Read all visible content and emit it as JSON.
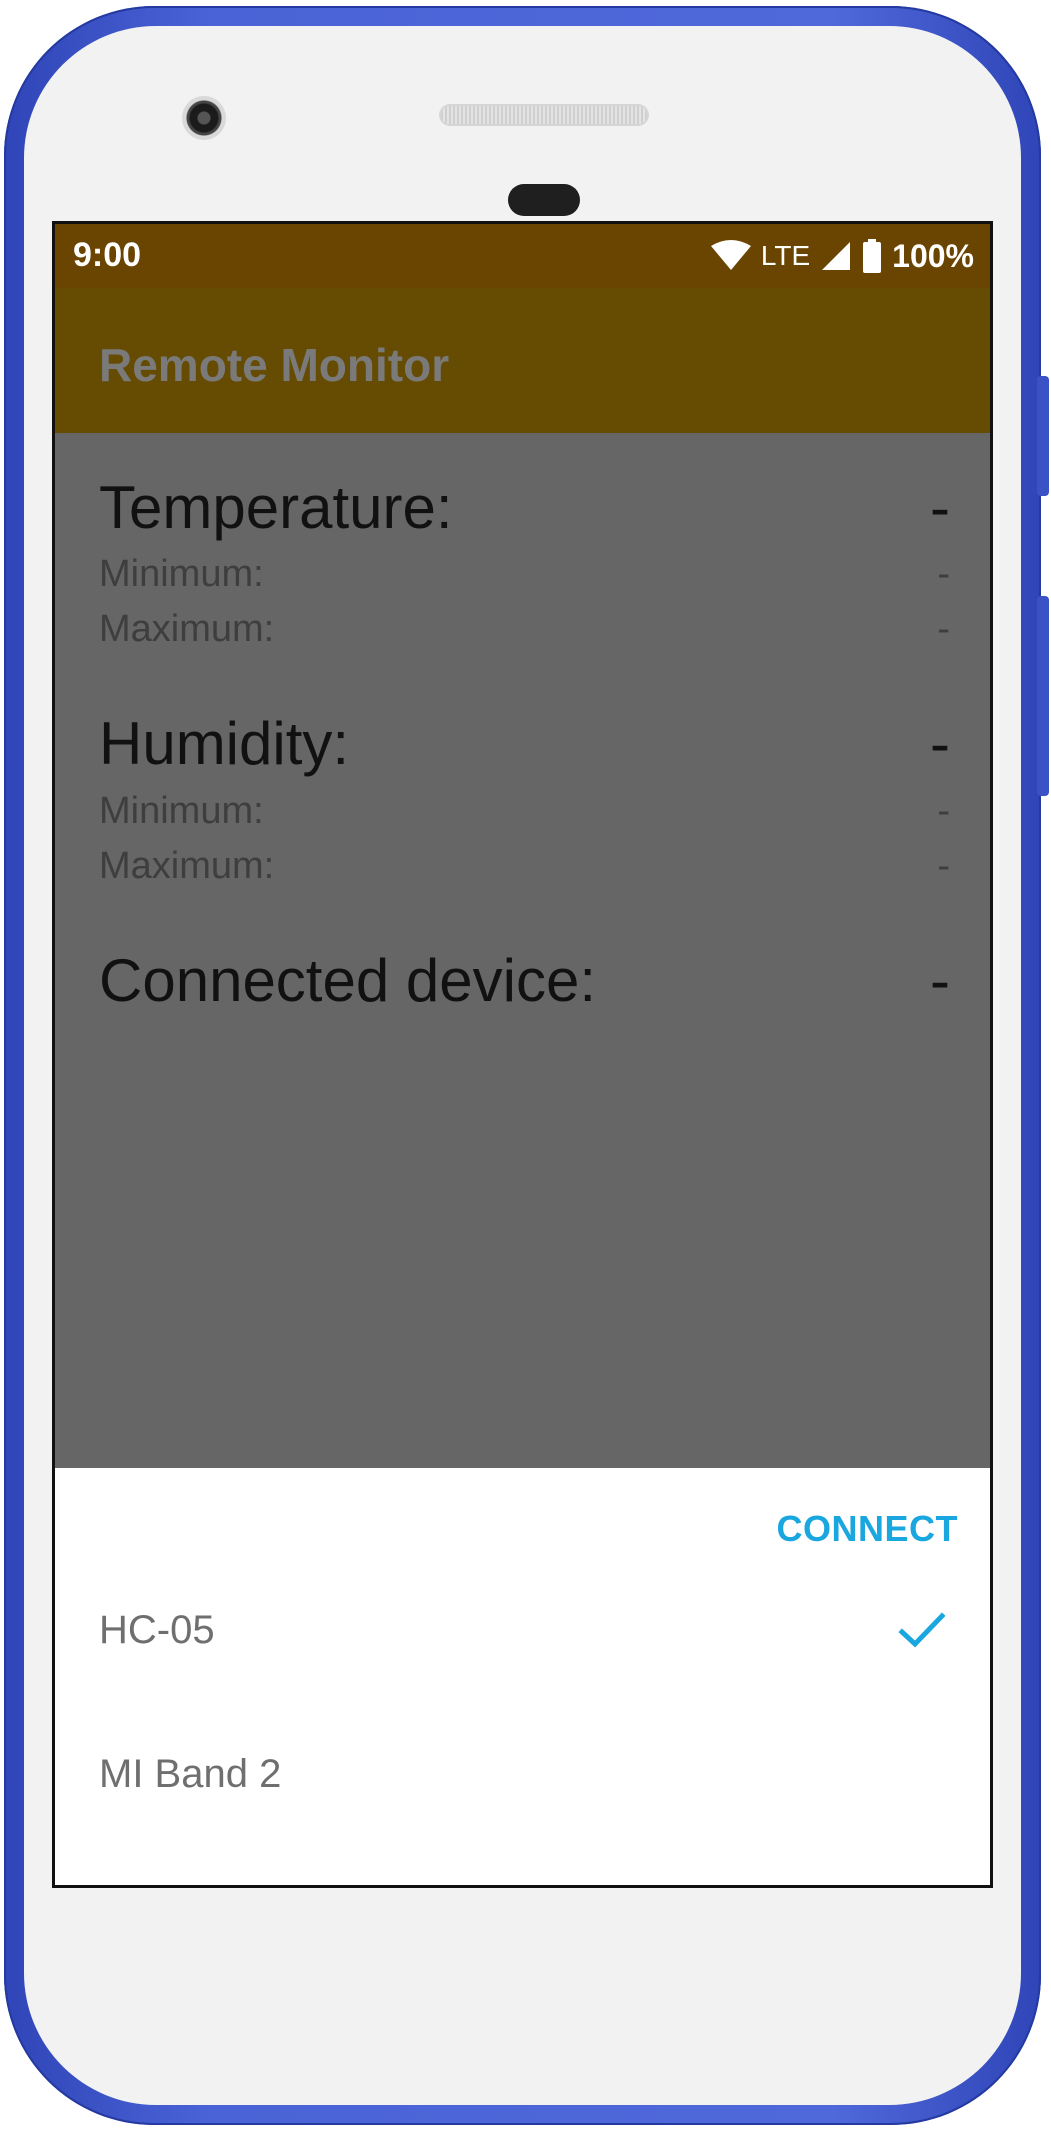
{
  "status_bar": {
    "time": "9:00",
    "network": "LTE",
    "battery": "100%",
    "icons": [
      "wifi-icon",
      "signal-icon",
      "battery-icon"
    ]
  },
  "app": {
    "title": "Remote Monitor"
  },
  "readings": {
    "temperature": {
      "label": "Temperature:",
      "value": "-",
      "min_label": "Minimum:",
      "min_value": "-",
      "max_label": "Maximum:",
      "max_value": "-"
    },
    "humidity": {
      "label": "Humidity:",
      "value": "-",
      "min_label": "Minimum:",
      "min_value": "-",
      "max_label": "Maximum:",
      "max_value": "-"
    },
    "connected_device": {
      "label": "Connected device:",
      "value": "-"
    }
  },
  "sheet": {
    "connect_label": "CONNECT",
    "devices": [
      {
        "name": "HC-05",
        "selected": true
      },
      {
        "name": "MI Band 2",
        "selected": false
      }
    ]
  },
  "colors": {
    "status_bar": "#6a4401",
    "app_bar": "#664c02",
    "scrim_content": "#666666",
    "accent": "#1aa6df",
    "device_frame": "#4a63d6"
  }
}
